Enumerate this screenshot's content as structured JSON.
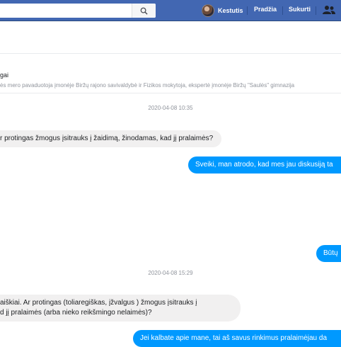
{
  "topbar": {
    "search_value": "",
    "user_name": "Kestutis",
    "home_label": "Pradžia",
    "create_label": "Sukurti"
  },
  "conversation": {
    "title_fragment": "gai",
    "subtitle": "ės mero pavaduotoja įmonėje Biržų rajono savivaldybė ir Fizikos mokytoja, ekspertė įmonėje Biržų \"Saulės\" gimnazija"
  },
  "messages": {
    "timestamp1": "2020-04-08 10:35",
    "in1": "r protingas žmogus įsitrauks į žaidimą, žinodamas, kad jį pralaimės?",
    "out1": "Sveiki, man atrodo, kad mes jau diskusiją ta",
    "out2": "Būtų",
    "timestamp2": "2020-04-08 15:29",
    "in2_line1": "aiškiai. Ar protingas (toliaregiškas, įžvalgus ) žmogus įsitrauks į",
    "in2_line2": "d jį pralaimės (arba nieko reikšmingo nelaimės)?",
    "out3": "Jei kalbate apie mane, tai aš savus rinkimus pralaimėjau da"
  },
  "colors": {
    "topbar": "#4267b2",
    "outgoing_bubble": "#0099ff",
    "incoming_bubble": "#f1f0f0"
  }
}
